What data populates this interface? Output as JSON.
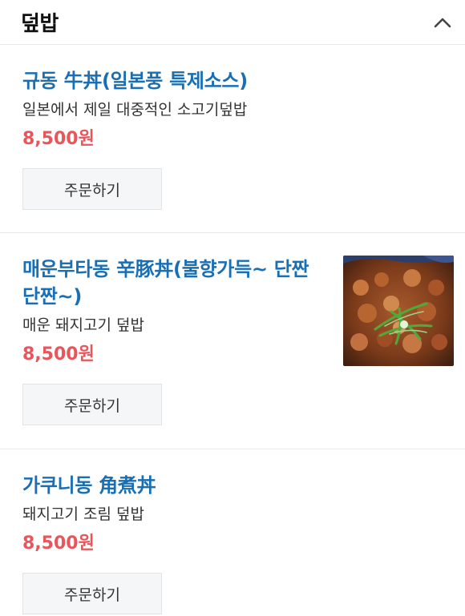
{
  "header": {
    "title": "덮밥",
    "toggle_icon": "chevron-up-icon"
  },
  "items": [
    {
      "name": "규동 牛丼(일본풍 특제소스)",
      "description": "일본에서 제일 대중적인 소고기덮밥",
      "price": "8,500원",
      "button": "주문하기"
    },
    {
      "name": "매운부타동 辛豚丼(불향가득~ 단짠단짠~)",
      "description": "매운 돼지고기 덮밥",
      "price": "8,500원",
      "button": "주문하기",
      "image": "spicy-pork-bowl-photo"
    },
    {
      "name": "가쿠니동 角煮丼",
      "description": "돼지고기 조림 덮밥",
      "price": "8,500원",
      "button": "주문하기"
    }
  ],
  "colors": {
    "title": "#1a6fb3",
    "price": "#e8565b"
  }
}
